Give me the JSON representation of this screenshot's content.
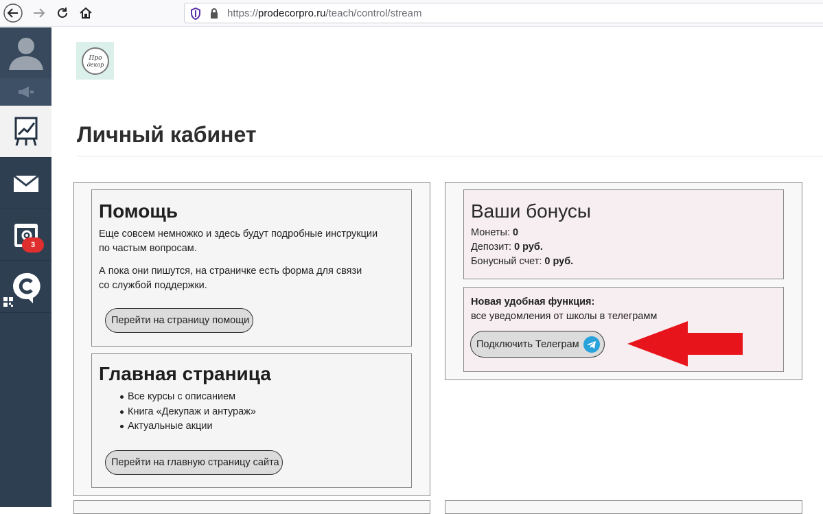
{
  "browser": {
    "url_prefix": "https://",
    "url_domain": "prodecorpro.ru",
    "url_path": "/teach/control/stream"
  },
  "sidebar": {
    "notification_count": "3",
    "icons": [
      "user-icon",
      "megaphone-icon",
      "training-chart-icon",
      "mail-icon",
      "settings-window-icon",
      "chat-c-icon"
    ]
  },
  "logo": {
    "text": "Про декор"
  },
  "page": {
    "title": "Личный кабинет"
  },
  "help": {
    "title": "Помощь",
    "para1": "Еще совсем немножко и здесь будут подробные инструкции по частым вопросам.",
    "para2": "А пока они пишутся, на страничке есть форма для связи со службой поддержки.",
    "button": "Перейти на страницу помощи"
  },
  "home": {
    "title": "Главная страница",
    "items": [
      "Все курсы с описанием",
      "Книга «Декупаж и антураж»",
      "Актуальные акции"
    ],
    "button": "Перейти на главную страницу сайта"
  },
  "bonuses": {
    "title": "Ваши бонусы",
    "coins_label": "Монеты: ",
    "coins_value": "0",
    "deposit_label": "Депозит: ",
    "deposit_value": "0 руб.",
    "bonus_label": "Бонусный счет: ",
    "bonus_value": "0 руб."
  },
  "telegram": {
    "heading": "Новая удобная функция:",
    "text": "все уведомления от школы в телеграмм",
    "button": "Подключить Телеграм"
  },
  "colors": {
    "sidebar": "#2f3f52",
    "badge": "#e02e2e",
    "arrow": "#e8141c",
    "telegram": "#2aa3dd"
  }
}
